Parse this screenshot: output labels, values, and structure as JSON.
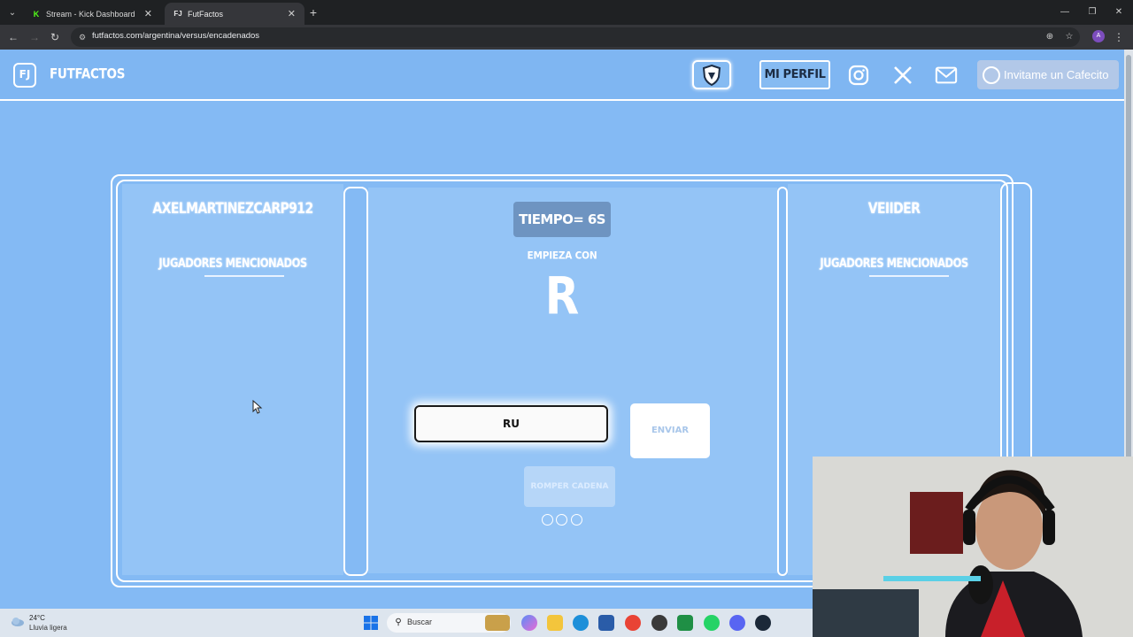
{
  "browser": {
    "tabs": [
      {
        "title": "Stream - Kick Dashboard",
        "active": false
      },
      {
        "title": "FutFactos",
        "active": true
      }
    ],
    "url": "futfactos.com/argentina/versus/encadenados",
    "profile_initial": "A"
  },
  "site": {
    "logo_text": "FUTFACTOS",
    "logo_mark": "FJ",
    "perfil_label": "MI PERFIL",
    "cafecito_label": "Invitame un Cafecito"
  },
  "game": {
    "player_left": "AXELMARTINEZCARP912",
    "player_right": "VEIIDER",
    "mentioned_label": "JUGADORES MENCIONADOS",
    "timer": "TIEMPO= 6S",
    "starts_with_label": "EMPIEZA CON",
    "letter": "R",
    "input_value": "RU",
    "enviar_label": "ENVIAR",
    "romper_label": "ROMPER CADENA",
    "lives_total": 3
  },
  "taskbar": {
    "temperature": "24°C",
    "weather": "Lluvia ligera",
    "search_label": "Buscar"
  },
  "colors": {
    "page_bg": "#84baf4",
    "panel_bg": "#94c4f6",
    "timer_bg": "#6e94c1"
  }
}
